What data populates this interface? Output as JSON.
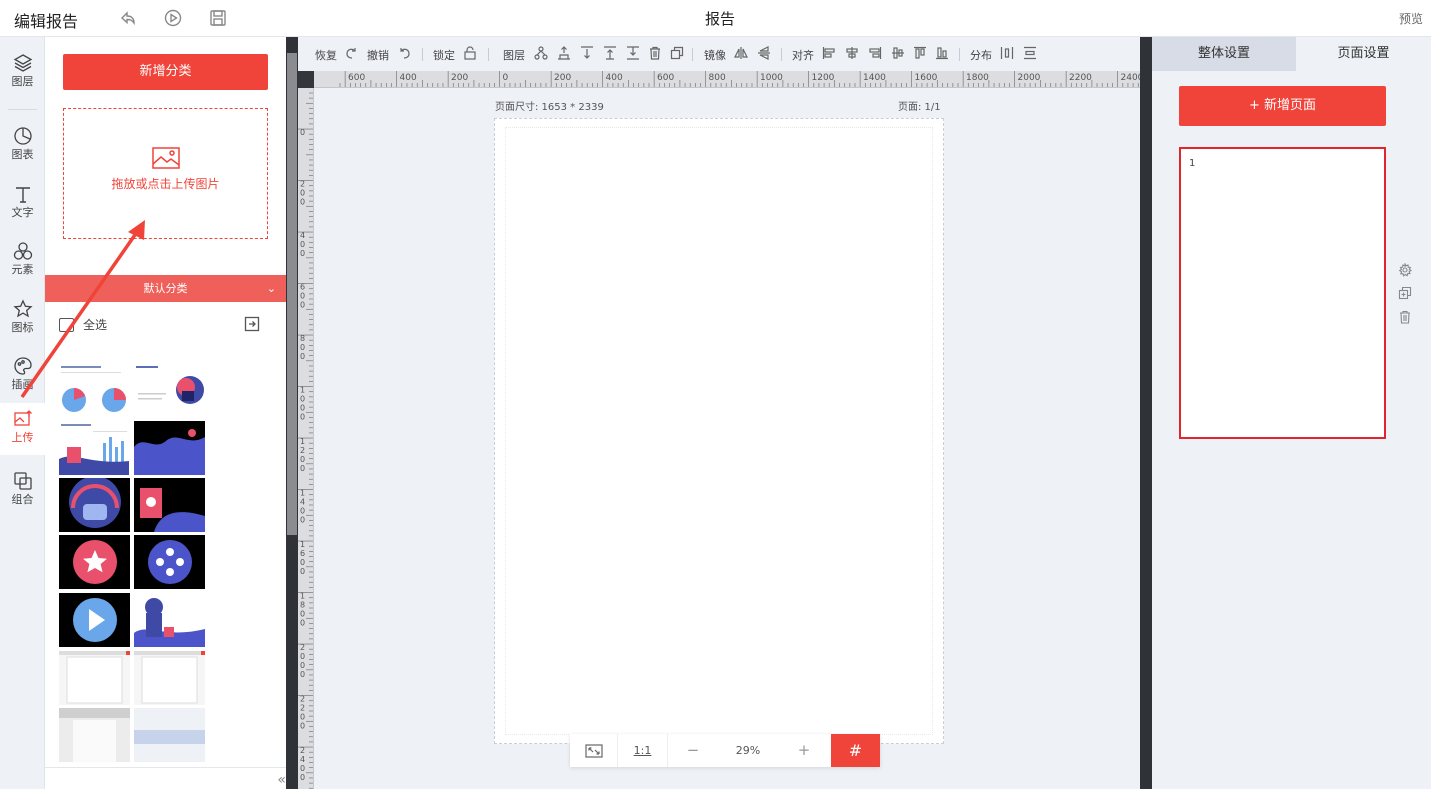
{
  "app": {
    "title": "编辑报告",
    "doc_title": "报告",
    "preview_label": "预览"
  },
  "nav": {
    "items": [
      {
        "label": "图层",
        "icon": "layers-icon"
      },
      {
        "label": "图表",
        "icon": "pie-chart-icon"
      },
      {
        "label": "文字",
        "icon": "text-icon"
      },
      {
        "label": "元素",
        "icon": "shapes-icon"
      },
      {
        "label": "图标",
        "icon": "star-icon"
      },
      {
        "label": "插画",
        "icon": "palette-icon"
      },
      {
        "label": "上传",
        "icon": "upload-image-icon"
      },
      {
        "label": "组合",
        "icon": "group-icon"
      }
    ],
    "active": "上传"
  },
  "panel": {
    "add_category_label": "新增分类",
    "upload_hint": "拖放或点击上传图片",
    "category_label": "默认分类",
    "select_all_label": "全选"
  },
  "toolbar": {
    "redo": "恢复",
    "undo": "撤销",
    "lock": "锁定",
    "layer": "图层",
    "mirror": "镜像",
    "align": "对齐",
    "distribute": "分布"
  },
  "canvas": {
    "page_size_label": "页面尺寸: 1653 * 2339",
    "page_number_label": "页面: 1/1",
    "ruler_h": [
      "600",
      "400",
      "200",
      "0",
      "200",
      "400",
      "600",
      "800",
      "1000",
      "1200",
      "1400",
      "1600",
      "1800",
      "2000",
      "2200",
      "2400"
    ],
    "ruler_v": [
      "0",
      "200",
      "400",
      "600",
      "800",
      "1000",
      "1200",
      "1400",
      "1600",
      "1800",
      "2000",
      "2200",
      "2400"
    ]
  },
  "zoom": {
    "ratio_label": "1:1",
    "minus": "−",
    "percent": "29%",
    "plus": "+",
    "grid_glyph": "#"
  },
  "right_panel": {
    "tab_global": "整体设置",
    "tab_page": "页面设置",
    "add_page_label": "+ 新增页面",
    "page_thumb_number": "1"
  },
  "colors": {
    "accent": "#f0443a",
    "accent_light": "#f0605a",
    "page_thumb_border": "#e0262a"
  }
}
